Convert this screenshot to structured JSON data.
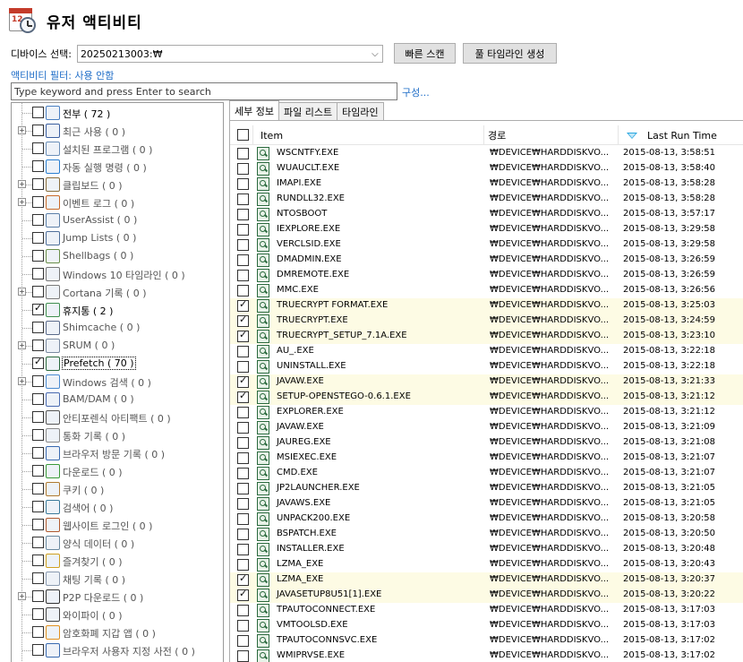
{
  "title": "유저 액티비티",
  "device": {
    "label": "디바이스 선택:",
    "value": "20250213003:₩"
  },
  "buttons": {
    "quick_scan": "빠른 스캔",
    "full_timeline": "풀 타임라인 생성"
  },
  "filter_link": "액티비티 필터: 사용 안함",
  "search": {
    "placeholder": "Type keyword and press Enter to search",
    "value": ""
  },
  "config_link": "구성...",
  "tree": {
    "items": [
      {
        "label": "전부 ( 72 )",
        "icon": "search-doc-icon",
        "checked": false,
        "expandable": false,
        "style": "bold"
      },
      {
        "label": "최근 사용 ( 0 )",
        "icon": "recent-docs-icon",
        "checked": false,
        "expandable": true,
        "style": "dim"
      },
      {
        "label": "설치된 프로그램 ( 0 )",
        "icon": "installer-icon",
        "checked": false,
        "expandable": false,
        "style": "dim"
      },
      {
        "label": "자동 실행 명령 ( 0 )",
        "icon": "autorun-icon",
        "checked": false,
        "expandable": false,
        "style": "dim"
      },
      {
        "label": "클립보드 ( 0 )",
        "icon": "clipboard-icon",
        "checked": false,
        "expandable": true,
        "style": "dim"
      },
      {
        "label": "이벤트 로그 ( 0 )",
        "icon": "event-log-icon",
        "checked": false,
        "expandable": true,
        "style": "dim"
      },
      {
        "label": "UserAssist ( 0 )",
        "icon": "user-assist-icon",
        "checked": false,
        "expandable": false,
        "style": "dim"
      },
      {
        "label": "Jump Lists ( 0 )",
        "icon": "jump-list-icon",
        "checked": false,
        "expandable": false,
        "style": "dim"
      },
      {
        "label": "Shellbags ( 0 )",
        "icon": "shellbags-icon",
        "checked": false,
        "expandable": false,
        "style": "dim"
      },
      {
        "label": "Windows 10 타임라인 ( 0 )",
        "icon": "timeline-icon",
        "checked": false,
        "expandable": false,
        "style": "dim"
      },
      {
        "label": "Cortana 기록 ( 0 )",
        "icon": "cortana-search-icon",
        "checked": false,
        "expandable": true,
        "style": "dim"
      },
      {
        "label": "휴지통 ( 2 )",
        "icon": "recycle-bin-icon",
        "checked": true,
        "expandable": false,
        "style": "bold"
      },
      {
        "label": "Shimcache ( 0 )",
        "icon": "shimcache-icon",
        "checked": false,
        "expandable": false,
        "style": "dim"
      },
      {
        "label": "SRUM ( 0 )",
        "icon": "srum-icon",
        "checked": false,
        "expandable": true,
        "style": "dim"
      },
      {
        "label": "Prefetch ( 70 )",
        "icon": "prefetch-icon",
        "checked": true,
        "expandable": false,
        "style": "focus"
      },
      {
        "label": "Windows 검색 ( 0 )",
        "icon": "windows-search-icon",
        "checked": false,
        "expandable": true,
        "style": "dim"
      },
      {
        "label": "BAM/DAM ( 0 )",
        "icon": "bam-dam-icon",
        "checked": false,
        "expandable": false,
        "style": "dim"
      },
      {
        "label": "안티포렌식 아티팩트 ( 0 )",
        "icon": "anti-forensic-icon",
        "checked": false,
        "expandable": false,
        "style": "dim"
      },
      {
        "label": "통화 기록 ( 0 )",
        "icon": "call-log-icon",
        "checked": false,
        "expandable": false,
        "style": "dim"
      },
      {
        "label": "브라우저 방문 기록 ( 0 )",
        "icon": "browser-history-icon",
        "checked": false,
        "expandable": false,
        "style": "dim"
      },
      {
        "label": "다운로드 ( 0 )",
        "icon": "download-icon",
        "checked": false,
        "expandable": false,
        "style": "dim"
      },
      {
        "label": "쿠키 ( 0 )",
        "icon": "cookie-icon",
        "checked": false,
        "expandable": false,
        "style": "dim"
      },
      {
        "label": "검색어 ( 0 )",
        "icon": "search-terms-icon",
        "checked": false,
        "expandable": false,
        "style": "dim"
      },
      {
        "label": "웹사이트 로그인 ( 0 )",
        "icon": "website-login-icon",
        "checked": false,
        "expandable": false,
        "style": "dim"
      },
      {
        "label": "양식 데이터 ( 0 )",
        "icon": "form-data-icon",
        "checked": false,
        "expandable": false,
        "style": "dim"
      },
      {
        "label": "즐겨찾기 ( 0 )",
        "icon": "favorites-star-icon",
        "checked": false,
        "expandable": false,
        "style": "dim"
      },
      {
        "label": "채팅 기록 ( 0 )",
        "icon": "chat-icon",
        "checked": false,
        "expandable": false,
        "style": "dim"
      },
      {
        "label": "P2P 다운로드 ( 0 )",
        "icon": "p2p-icon",
        "checked": false,
        "expandable": true,
        "style": "dim"
      },
      {
        "label": "와이파이 ( 0 )",
        "icon": "wifi-icon",
        "checked": false,
        "expandable": false,
        "style": "dim"
      },
      {
        "label": "암호화폐 지갑 앱 ( 0 )",
        "icon": "crypto-wallet-icon",
        "checked": false,
        "expandable": false,
        "style": "dim"
      },
      {
        "label": "브라우저 사용자 지정 사전 ( 0 )",
        "icon": "dictionary-icon",
        "checked": false,
        "expandable": false,
        "style": "dim"
      }
    ]
  },
  "tabs": [
    "세부 정보",
    "파일 리스트",
    "타임라인"
  ],
  "grid": {
    "columns": {
      "item": "Item",
      "path": "경로",
      "time": "Last Run Time"
    },
    "rows": [
      {
        "item": "WSCNTFY.EXE",
        "path": "₩DEVICE₩HARDDISKVO...",
        "time": "2015-08-13, 3:58:51",
        "checked": false
      },
      {
        "item": "WUAUCLT.EXE",
        "path": "₩DEVICE₩HARDDISKVO...",
        "time": "2015-08-13, 3:58:40",
        "checked": false
      },
      {
        "item": "IMAPI.EXE",
        "path": "₩DEVICE₩HARDDISKVO...",
        "time": "2015-08-13, 3:58:28",
        "checked": false
      },
      {
        "item": "RUNDLL32.EXE",
        "path": "₩DEVICE₩HARDDISKVO...",
        "time": "2015-08-13, 3:58:28",
        "checked": false
      },
      {
        "item": "NTOSBOOT",
        "path": "₩DEVICE₩HARDDISKVO...",
        "time": "2015-08-13, 3:57:17",
        "checked": false
      },
      {
        "item": "IEXPLORE.EXE",
        "path": "₩DEVICE₩HARDDISKVO...",
        "time": "2015-08-13, 3:29:58",
        "checked": false
      },
      {
        "item": "VERCLSID.EXE",
        "path": "₩DEVICE₩HARDDISKVO...",
        "time": "2015-08-13, 3:29:58",
        "checked": false
      },
      {
        "item": "DMADMIN.EXE",
        "path": "₩DEVICE₩HARDDISKVO...",
        "time": "2015-08-13, 3:26:59",
        "checked": false
      },
      {
        "item": "DMREMOTE.EXE",
        "path": "₩DEVICE₩HARDDISKVO...",
        "time": "2015-08-13, 3:26:59",
        "checked": false
      },
      {
        "item": "MMC.EXE",
        "path": "₩DEVICE₩HARDDISKVO...",
        "time": "2015-08-13, 3:26:56",
        "checked": false
      },
      {
        "item": "TRUECRYPT FORMAT.EXE",
        "path": "₩DEVICE₩HARDDISKVO...",
        "time": "2015-08-13, 3:25:03",
        "checked": true
      },
      {
        "item": "TRUECRYPT.EXE",
        "path": "₩DEVICE₩HARDDISKVO...",
        "time": "2015-08-13, 3:24:59",
        "checked": true
      },
      {
        "item": "TRUECRYPT_SETUP_7.1A.EXE",
        "path": "₩DEVICE₩HARDDISKVO...",
        "time": "2015-08-13, 3:23:10",
        "checked": true
      },
      {
        "item": "AU_.EXE",
        "path": "₩DEVICE₩HARDDISKVO...",
        "time": "2015-08-13, 3:22:18",
        "checked": false
      },
      {
        "item": "UNINSTALL.EXE",
        "path": "₩DEVICE₩HARDDISKVO...",
        "time": "2015-08-13, 3:22:18",
        "checked": false
      },
      {
        "item": "JAVAW.EXE",
        "path": "₩DEVICE₩HARDDISKVO...",
        "time": "2015-08-13, 3:21:33",
        "checked": true
      },
      {
        "item": "SETUP-OPENSTEGO-0.6.1.EXE",
        "path": "₩DEVICE₩HARDDISKVO...",
        "time": "2015-08-13, 3:21:12",
        "checked": true
      },
      {
        "item": "EXPLORER.EXE",
        "path": "₩DEVICE₩HARDDISKVO...",
        "time": "2015-08-13, 3:21:12",
        "checked": false
      },
      {
        "item": "JAVAW.EXE",
        "path": "₩DEVICE₩HARDDISKVO...",
        "time": "2015-08-13, 3:21:09",
        "checked": false
      },
      {
        "item": "JAUREG.EXE",
        "path": "₩DEVICE₩HARDDISKVO...",
        "time": "2015-08-13, 3:21:08",
        "checked": false
      },
      {
        "item": "MSIEXEC.EXE",
        "path": "₩DEVICE₩HARDDISKVO...",
        "time": "2015-08-13, 3:21:07",
        "checked": false
      },
      {
        "item": "CMD.EXE",
        "path": "₩DEVICE₩HARDDISKVO...",
        "time": "2015-08-13, 3:21:07",
        "checked": false
      },
      {
        "item": "JP2LAUNCHER.EXE",
        "path": "₩DEVICE₩HARDDISKVO...",
        "time": "2015-08-13, 3:21:05",
        "checked": false
      },
      {
        "item": "JAVAWS.EXE",
        "path": "₩DEVICE₩HARDDISKVO...",
        "time": "2015-08-13, 3:21:05",
        "checked": false
      },
      {
        "item": "UNPACK200.EXE",
        "path": "₩DEVICE₩HARDDISKVO...",
        "time": "2015-08-13, 3:20:58",
        "checked": false
      },
      {
        "item": "BSPATCH.EXE",
        "path": "₩DEVICE₩HARDDISKVO...",
        "time": "2015-08-13, 3:20:50",
        "checked": false
      },
      {
        "item": "INSTALLER.EXE",
        "path": "₩DEVICE₩HARDDISKVO...",
        "time": "2015-08-13, 3:20:48",
        "checked": false
      },
      {
        "item": "LZMA_EXE",
        "path": "₩DEVICE₩HARDDISKVO...",
        "time": "2015-08-13, 3:20:43",
        "checked": false
      },
      {
        "item": "LZMA_EXE",
        "path": "₩DEVICE₩HARDDISKVO...",
        "time": "2015-08-13, 3:20:37",
        "checked": true
      },
      {
        "item": "JAVASETUP8U51[1].EXE",
        "path": "₩DEVICE₩HARDDISKVO...",
        "time": "2015-08-13, 3:20:22",
        "checked": true
      },
      {
        "item": "TPAUTOCONNECT.EXE",
        "path": "₩DEVICE₩HARDDISKVO...",
        "time": "2015-08-13, 3:17:03",
        "checked": false
      },
      {
        "item": "VMTOOLSD.EXE",
        "path": "₩DEVICE₩HARDDISKVO...",
        "time": "2015-08-13, 3:17:03",
        "checked": false
      },
      {
        "item": "TPAUTOCONNSVC.EXE",
        "path": "₩DEVICE₩HARDDISKVO...",
        "time": "2015-08-13, 3:17:02",
        "checked": false
      },
      {
        "item": "WMIPRVSE.EXE",
        "path": "₩DEVICE₩HARDDISKVO...",
        "time": "2015-08-13, 3:17:02",
        "checked": false
      }
    ]
  },
  "colors": {
    "link": "#1d6cc7",
    "highlight_row": "#fdfbe4",
    "sort_arrow": "#2aa7e0"
  }
}
